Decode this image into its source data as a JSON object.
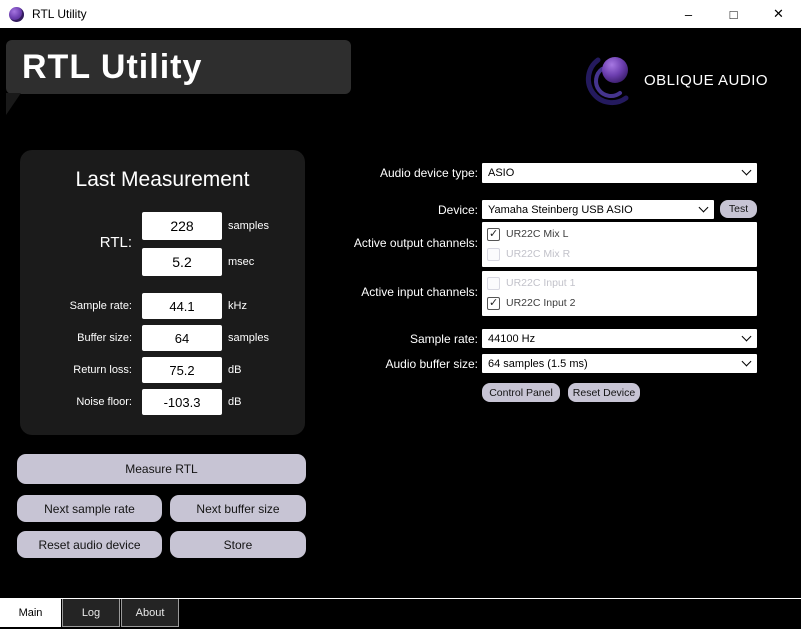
{
  "window": {
    "title": "RTL Utility",
    "controls": {
      "minimize": "–",
      "maximize": "□",
      "close": "✕"
    }
  },
  "header": {
    "app_title": "RTL Utility",
    "brand": "OBLIQUE AUDIO"
  },
  "colors": {
    "accent_purple": "#6d3fb0",
    "button_bg": "#c7c4d4",
    "card_bg": "#1b1b1b"
  },
  "measurement": {
    "title": "Last Measurement",
    "rtl_label": "RTL:",
    "rtl_samples_value": "228",
    "rtl_samples_unit": "samples",
    "rtl_msec_value": "5.2",
    "rtl_msec_unit": "msec",
    "rows": [
      {
        "label": "Sample rate:",
        "value": "44.1",
        "unit": "kHz"
      },
      {
        "label": "Buffer size:",
        "value": "64",
        "unit": "samples"
      },
      {
        "label": "Return loss:",
        "value": "75.2",
        "unit": "dB"
      },
      {
        "label": "Noise floor:",
        "value": "-103.3",
        "unit": "dB"
      }
    ]
  },
  "actions": {
    "measure": "Measure RTL",
    "next_sample_rate": "Next sample rate",
    "next_buffer_size": "Next buffer size",
    "reset_audio_device": "Reset audio device",
    "store": "Store"
  },
  "device_form": {
    "audio_device_type_label": "Audio device type:",
    "audio_device_type_value": "ASIO",
    "device_label": "Device:",
    "device_value": "Yamaha Steinberg USB ASIO",
    "test_button": "Test",
    "output_channels_label": "Active output channels:",
    "output_channels": [
      {
        "label": "UR22C Mix L",
        "checked": true
      },
      {
        "label": "UR22C Mix R",
        "checked": false
      }
    ],
    "input_channels_label": "Active input channels:",
    "input_channels": [
      {
        "label": "UR22C Input 1",
        "checked": false
      },
      {
        "label": "UR22C Input 2",
        "checked": true
      }
    ],
    "sample_rate_label": "Sample rate:",
    "sample_rate_value": "44100 Hz",
    "buffer_size_label": "Audio buffer size:",
    "buffer_size_value": "64 samples (1.5 ms)",
    "control_panel_button": "Control Panel",
    "reset_device_button": "Reset Device"
  },
  "tabs": [
    {
      "label": "Main",
      "active": true
    },
    {
      "label": "Log",
      "active": false
    },
    {
      "label": "About",
      "active": false
    }
  ]
}
